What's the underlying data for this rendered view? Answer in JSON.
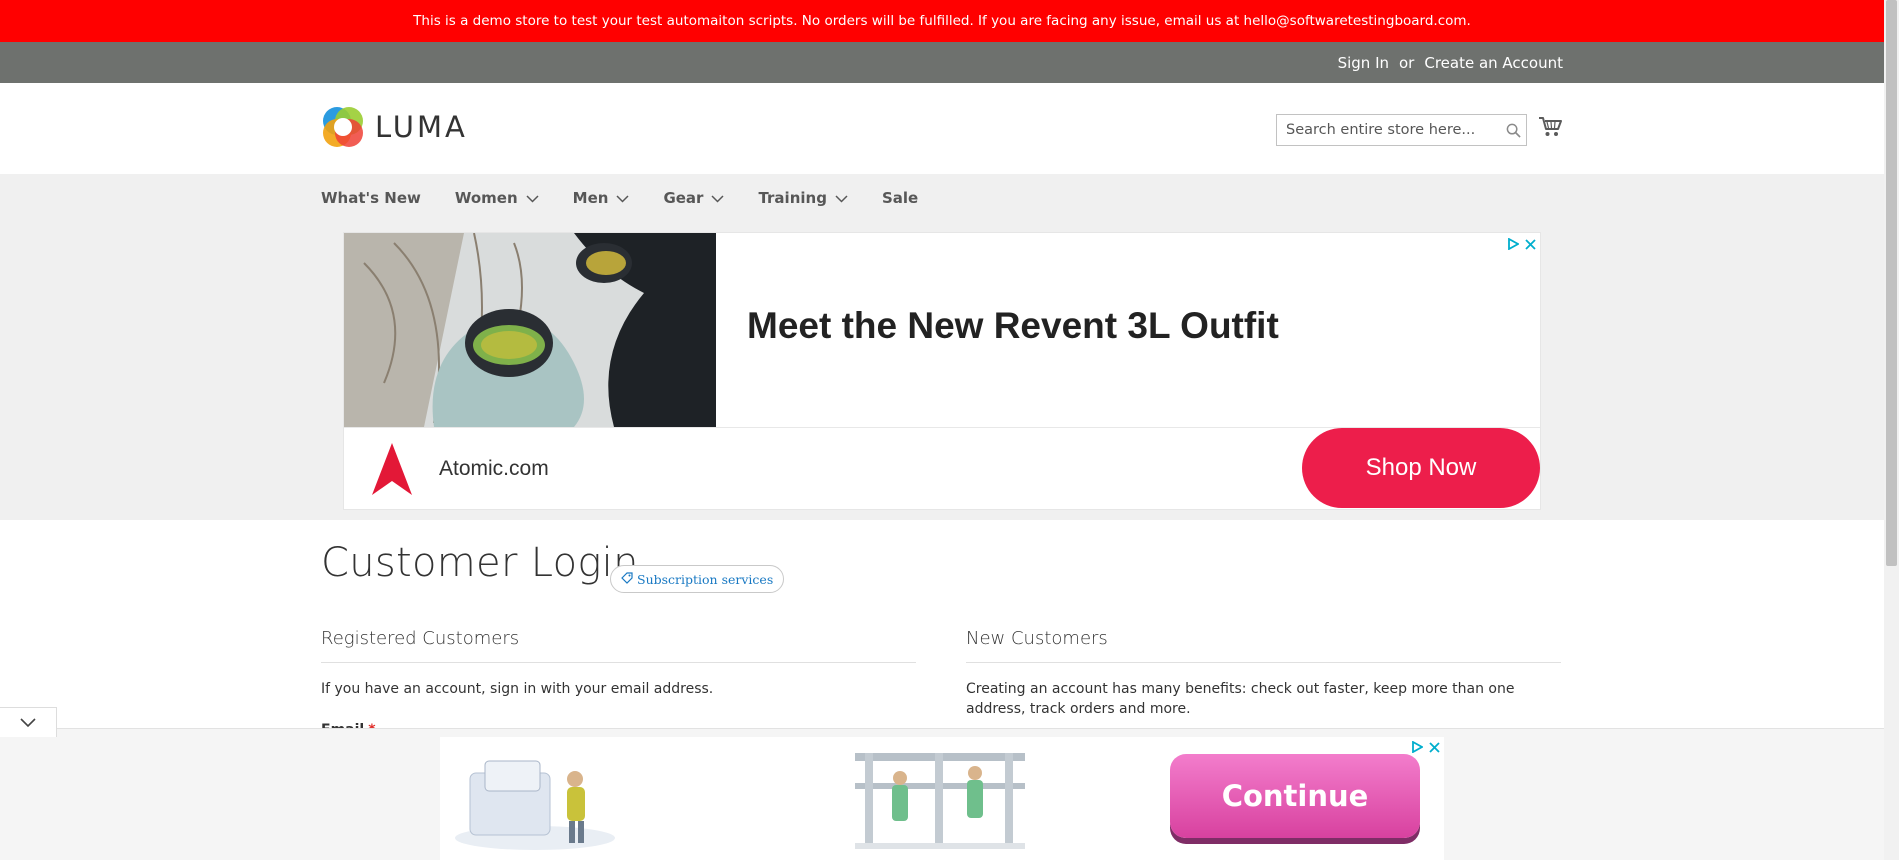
{
  "demo_notice": "This is a demo store to test your test automaiton scripts. No orders will be fulfilled. If you are facing any issue, email us at hello@softwaretestingboard.com.",
  "header_links": {
    "sign_in": "Sign In",
    "or": "or",
    "create_account": "Create an Account"
  },
  "logo": {
    "text": "LUMA"
  },
  "search": {
    "placeholder": "Search entire store here...",
    "icon": "search-icon"
  },
  "cart": {
    "icon": "cart-icon"
  },
  "nav": [
    {
      "label": "What's New",
      "has_dropdown": false
    },
    {
      "label": "Women",
      "has_dropdown": true
    },
    {
      "label": "Men",
      "has_dropdown": true
    },
    {
      "label": "Gear",
      "has_dropdown": true
    },
    {
      "label": "Training",
      "has_dropdown": true
    },
    {
      "label": "Sale",
      "has_dropdown": false
    }
  ],
  "top_ad": {
    "headline": "Meet the New Revent 3L Outfit",
    "brand": "Atomic.com",
    "cta": "Shop Now",
    "cta_color": "#ed1e4b"
  },
  "page": {
    "title": "Customer Login",
    "badge": "Subscription services"
  },
  "registered": {
    "heading": "Registered Customers",
    "text": "If you have an account, sign in with your email address.",
    "email_label": "Email",
    "required_mark": "*"
  },
  "new_customers": {
    "heading": "New Customers",
    "text": "Creating an account has many benefits: check out faster, keep more than one address, track orders and more."
  },
  "bottom_ad": {
    "cta": "Continue"
  },
  "colors": {
    "demo_bar": "#ff0000",
    "top_links_bar": "#6e716e",
    "link_blue": "#1979c3"
  }
}
